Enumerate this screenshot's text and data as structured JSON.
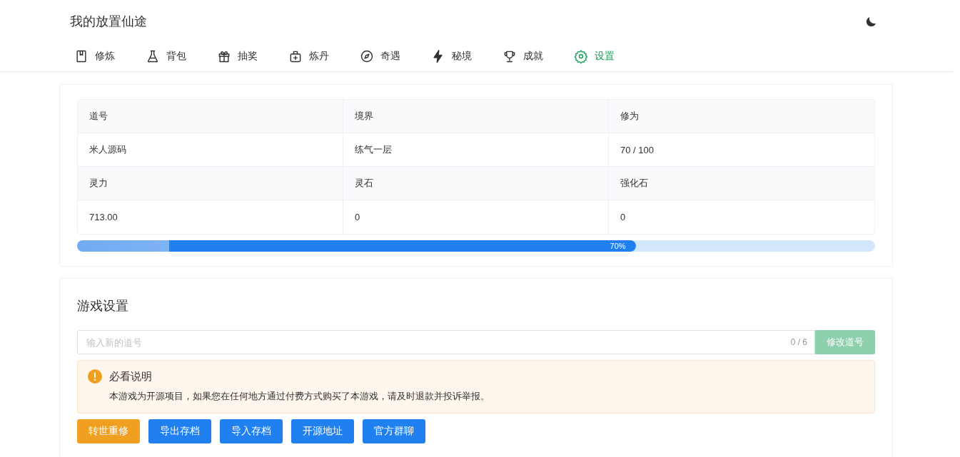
{
  "header": {
    "title": "我的放置仙途"
  },
  "nav": [
    {
      "label": "修炼",
      "selected": false
    },
    {
      "label": "背包",
      "selected": false
    },
    {
      "label": "抽奖",
      "selected": false
    },
    {
      "label": "炼丹",
      "selected": false
    },
    {
      "label": "奇遇",
      "selected": false
    },
    {
      "label": "秘境",
      "selected": false
    },
    {
      "label": "成就",
      "selected": false
    },
    {
      "label": "设置",
      "selected": true
    }
  ],
  "stats": [
    {
      "label": "道号",
      "value": "米人源码"
    },
    {
      "label": "境界",
      "value": "练气一层"
    },
    {
      "label": "修为",
      "value": "70 / 100"
    },
    {
      "label": "灵力",
      "value": "713.00"
    },
    {
      "label": "灵石",
      "value": "0"
    },
    {
      "label": "强化石",
      "value": "0"
    }
  ],
  "progress": {
    "level": 0.7,
    "label": "70%"
  },
  "settings": {
    "title": "游戏设置",
    "name_field": {
      "placeholder": "输入新的道号",
      "count": "0 / 6",
      "button": {
        "label": "修改道号",
        "disabled": true
      }
    },
    "notice": {
      "title": "必看说明",
      "text": "本游戏为开源项目，如果您在任何地方通过付费方式购买了本游戏，请及时退款并投诉举报。"
    },
    "buttons": [
      {
        "label": "转世重修",
        "kind": "warning"
      },
      {
        "label": "导出存档",
        "kind": "primary"
      },
      {
        "label": "导入存档",
        "kind": "primary"
      },
      {
        "label": "开源地址",
        "kind": "primary"
      },
      {
        "label": "官方群聊",
        "kind": "primary"
      }
    ]
  }
}
